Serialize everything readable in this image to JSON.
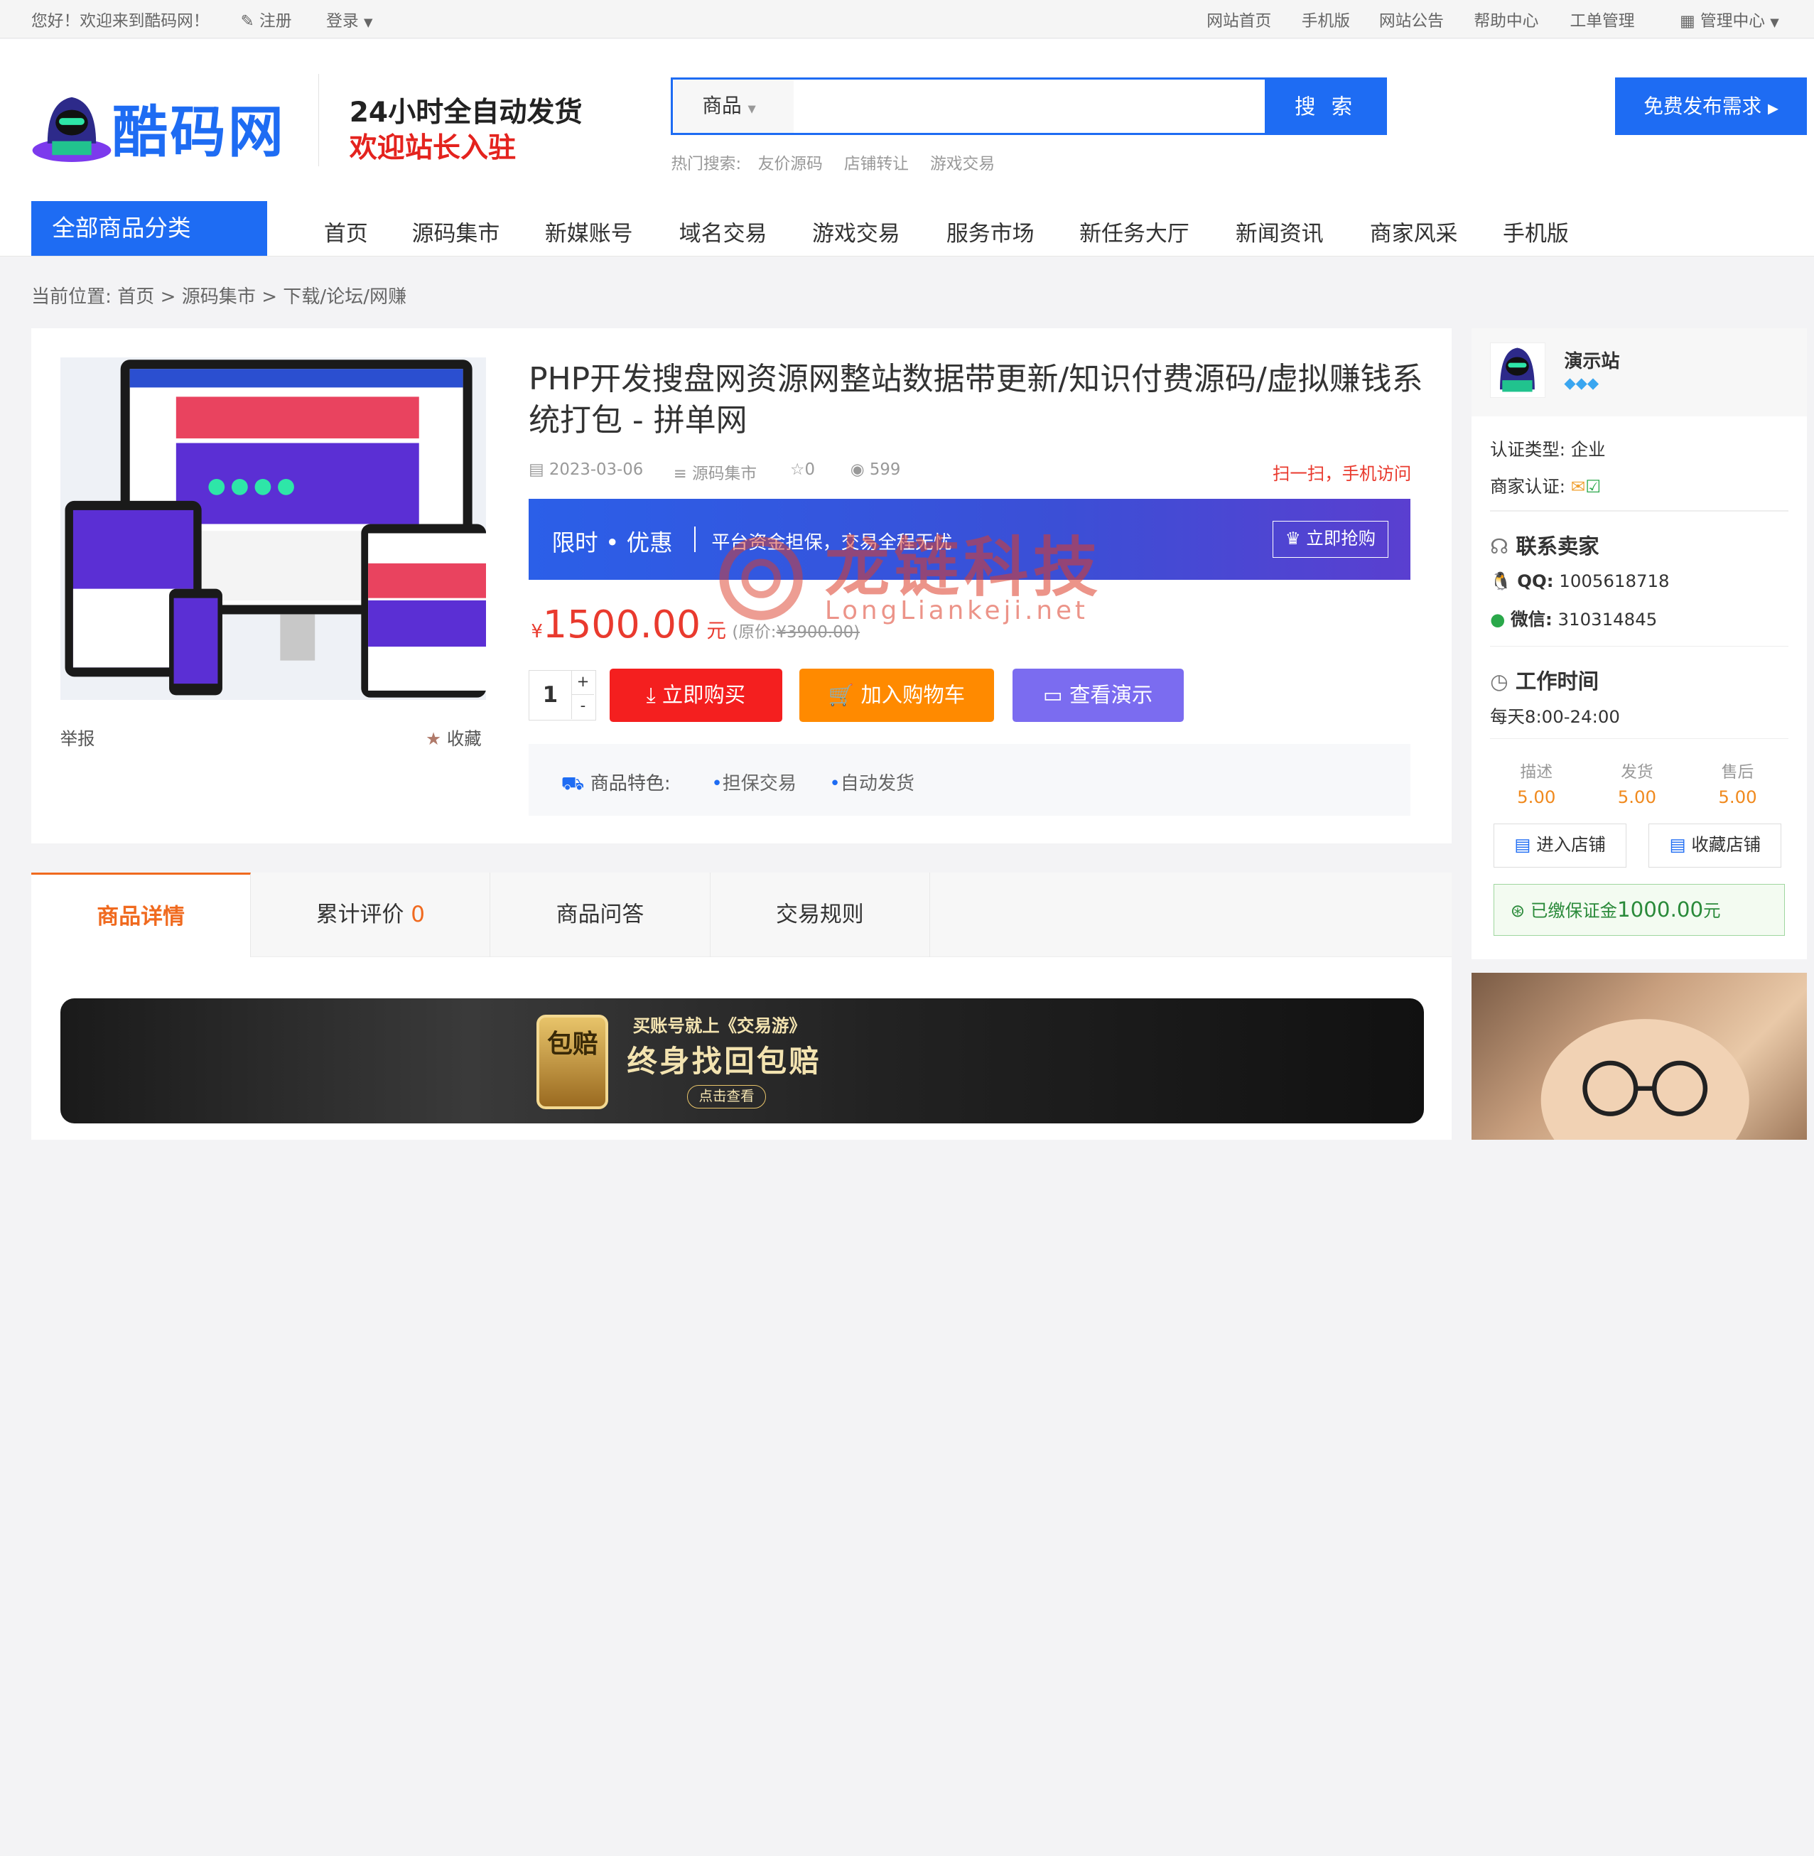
{
  "topbar": {
    "welcome": "您好！欢迎来到酷码网！",
    "register": "注册",
    "login": "登录",
    "links": [
      "网站首页",
      "手机版",
      "网站公告",
      "帮助中心",
      "工单管理"
    ],
    "admin": "管理中心"
  },
  "header": {
    "logo_text": "酷码网",
    "slogan1": "24小时全自动发货",
    "slogan2": "欢迎站长入驻",
    "search_type": "商品",
    "search_placeholder": "",
    "search_btn": "搜 索",
    "hot_label": "热门搜索:",
    "hot": [
      "友价源码",
      "店铺转让",
      "游戏交易"
    ],
    "publish": "免费发布需求"
  },
  "nav": {
    "category": "全部商品分类",
    "items": [
      "首页",
      "源码集市",
      "新媒账号",
      "域名交易",
      "游戏交易",
      "服务市场",
      "新任务大厅",
      "新闻资讯",
      "商家风采",
      "手机版"
    ]
  },
  "breadcrumb": {
    "label": "当前位置:",
    "items": [
      "首页",
      "源码集市",
      "下载/论坛/网赚"
    ],
    "sep": ">"
  },
  "product": {
    "title": "PHP开发搜盘网资源网整站数据带更新/知识付费源码/虚拟赚钱系统打包 - 拼单网",
    "date": "2023-03-06",
    "category": "源码集市",
    "stars": "0",
    "views": "599",
    "mobile": "扫一扫，手机访问",
    "promo_title": "限时 • 优惠",
    "promo_text": "平台资金担保，交易全程无忧",
    "promo_btn": "立即抢购",
    "currency": "¥",
    "price": "1500.00",
    "unit": "元",
    "orig_label": "(原价:",
    "orig_price": "¥3900.00)",
    "qty": "1",
    "buy": "立即购买",
    "cart": "加入购物车",
    "demo": "查看演示",
    "feature_label": "商品特色:",
    "features": [
      "担保交易",
      "自动发货"
    ],
    "report": "举报",
    "favorite": "收藏"
  },
  "watermark": {
    "cn": "龙链科技",
    "en": "LongLiankeji.net"
  },
  "seller": {
    "name": "演示站",
    "auth_type_label": "认证类型:",
    "auth_type": "企业",
    "merchant_label": "商家认证:",
    "contact_title": "联系卖家",
    "qq_label": "QQ:",
    "qq": "1005618718",
    "wx_label": "微信:",
    "wx": "310314845",
    "hours_title": "工作时间",
    "hours": "每天8:00-24:00",
    "scores": [
      {
        "label": "描述",
        "value": "5.00"
      },
      {
        "label": "发货",
        "value": "5.00"
      },
      {
        "label": "售后",
        "value": "5.00"
      }
    ],
    "enter": "进入店铺",
    "collect": "收藏店铺",
    "deposit_label": "已缴保证金",
    "deposit": "1000.00",
    "deposit_unit": "元"
  },
  "tabs": [
    {
      "label": "商品详情"
    },
    {
      "label": "累计评价",
      "count": "0"
    },
    {
      "label": "商品问答"
    },
    {
      "label": "交易规则"
    }
  ],
  "banner": {
    "line1": "买账号就上《交易游》",
    "line2": "终身找回包赔",
    "badge": "包赔",
    "btn": "点击查看"
  },
  "colors": {
    "primary": "#1e6cf3",
    "price": "#e93a2e",
    "buy": "#f41f1f",
    "cart": "#ff8a00",
    "demo": "#7b6cf0",
    "accent": "#f08a1f"
  }
}
